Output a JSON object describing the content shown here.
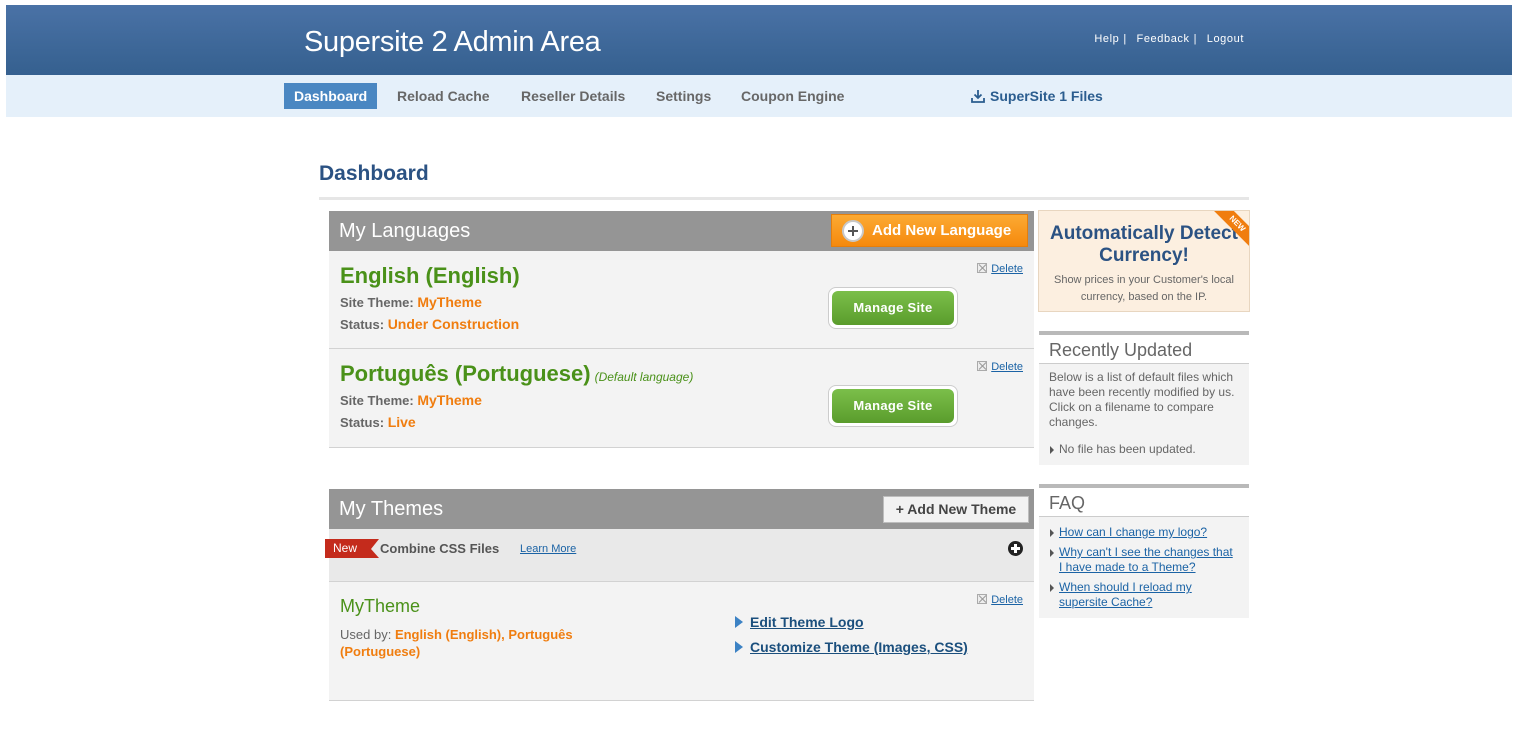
{
  "header": {
    "app_title": "Supersite 2 Admin Area",
    "links": {
      "help": "Help",
      "feedback": "Feedback",
      "logout": "Logout"
    },
    "separator": "|"
  },
  "nav": {
    "dashboard": "Dashboard",
    "reload_cache": "Reload Cache",
    "reseller_details": "Reseller Details",
    "settings": "Settings",
    "coupon_engine": "Coupon Engine",
    "supersite1_files": "SuperSite 1 Files",
    "active": "Dashboard"
  },
  "page": {
    "title": "Dashboard"
  },
  "languages": {
    "title": "My Languages",
    "add_button": "Add New Language",
    "delete_label": "Delete",
    "manage_label": "Manage Site",
    "theme_label": "Site Theme:",
    "status_label": "Status:",
    "items": [
      {
        "name": "English (English)",
        "default_note": "",
        "theme": "MyTheme",
        "status": "Under Construction"
      },
      {
        "name": "Português (Portuguese)",
        "default_note": "(Default language)",
        "theme": "MyTheme",
        "status": "Live"
      }
    ]
  },
  "themes": {
    "title": "My Themes",
    "add_button": "+ Add New Theme",
    "new_badge": "New",
    "combine_label": "Combine CSS Files",
    "learn_more": "Learn More",
    "theme": {
      "name": "MyTheme",
      "used_by_label": "Used by:",
      "used_by": "English (English), Português (Portuguese)",
      "delete_label": "Delete",
      "edit_logo": "Edit Theme Logo",
      "customize": "Customize Theme (Images, CSS)"
    }
  },
  "sidebar": {
    "promo": {
      "corner": "NEW",
      "headline": "Automatically Detect Currency!",
      "text": "Show prices in your Customer's local currency, based on the IP."
    },
    "recently_updated": {
      "title": "Recently Updated",
      "text": "Below is a list of default files which have been recently modified by us. Click on a filename to compare changes.",
      "empty": "No file has been updated."
    },
    "faq": {
      "title": "FAQ",
      "items": [
        "How can I change my logo?",
        "Why can't I see the changes that I have made to a Theme?",
        "When should I reload my supersite Cache?"
      ]
    }
  },
  "colors": {
    "header_blue": "#3e6899",
    "nav_bg": "#e5f0fa",
    "active_tab": "#4a87c2",
    "green": "#4a9119",
    "orange": "#f07d0f",
    "panel_gray": "#959595"
  }
}
